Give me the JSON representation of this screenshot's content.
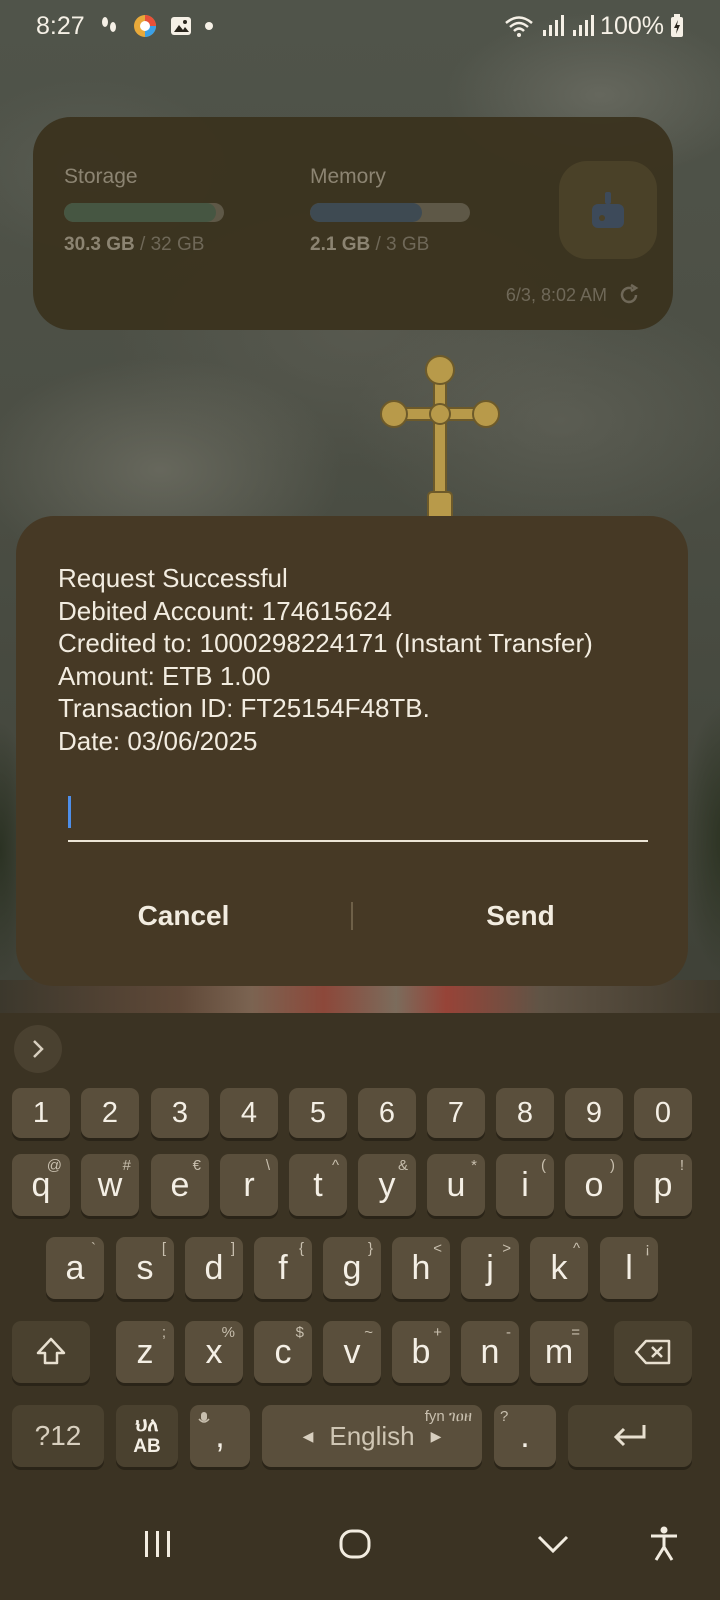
{
  "status_bar": {
    "time": "8:27",
    "battery": "100%"
  },
  "widget": {
    "storage_label": "Storage",
    "storage_used": "30.3 GB",
    "storage_total": "/ 32 GB",
    "storage_fraction": 0.95,
    "memory_label": "Memory",
    "memory_used": "2.1 GB",
    "memory_total": "/ 3 GB",
    "memory_fraction": 0.7,
    "timestamp": "6/3, 8:02 AM"
  },
  "dialog": {
    "lines": [
      "Request Successful",
      "Debited Account: 174615624",
      "Credited to: 1000298224171 (Instant Transfer)",
      "Amount: ETB 1.00",
      "Transaction ID: FT25154F48TB.",
      "Date: 03/06/2025"
    ],
    "input_value": "",
    "cancel_label": "Cancel",
    "send_label": "Send"
  },
  "keyboard": {
    "numbers": [
      "1",
      "2",
      "3",
      "4",
      "5",
      "6",
      "7",
      "8",
      "9",
      "0"
    ],
    "row1": [
      [
        "q",
        "@"
      ],
      [
        "w",
        "#"
      ],
      [
        "e",
        "€"
      ],
      [
        "r",
        "\\"
      ],
      [
        "t",
        "^"
      ],
      [
        "y",
        "&"
      ],
      [
        "u",
        "*"
      ],
      [
        "i",
        "("
      ],
      [
        "o",
        ")"
      ],
      [
        "p",
        "!"
      ]
    ],
    "row2": [
      [
        "a",
        "`"
      ],
      [
        "s",
        "["
      ],
      [
        "d",
        "]"
      ],
      [
        "f",
        "{"
      ],
      [
        "g",
        "}"
      ],
      [
        "h",
        "<"
      ],
      [
        "j",
        ">"
      ],
      [
        "k",
        "^"
      ],
      [
        "l",
        "¡"
      ]
    ],
    "row3": [
      [
        "z",
        ";"
      ],
      [
        "x",
        "%"
      ],
      [
        "c",
        "$"
      ],
      [
        "v",
        "~"
      ],
      [
        "b",
        "+"
      ],
      [
        "n",
        "-"
      ],
      [
        "m",
        "="
      ]
    ],
    "symbols_label": "?12",
    "lang_switch_top": "ህለ",
    "lang_switch_bottom": "AB",
    "comma": ",",
    "space_label": "English",
    "space_hint": "fyn ገዐዘ",
    "period_hint": "?",
    "period": "."
  },
  "colors": {
    "storage_fill": "#465642",
    "memory_fill": "#3e4a52",
    "dialog_bg": "#463925",
    "caret": "#4e8ee8"
  }
}
